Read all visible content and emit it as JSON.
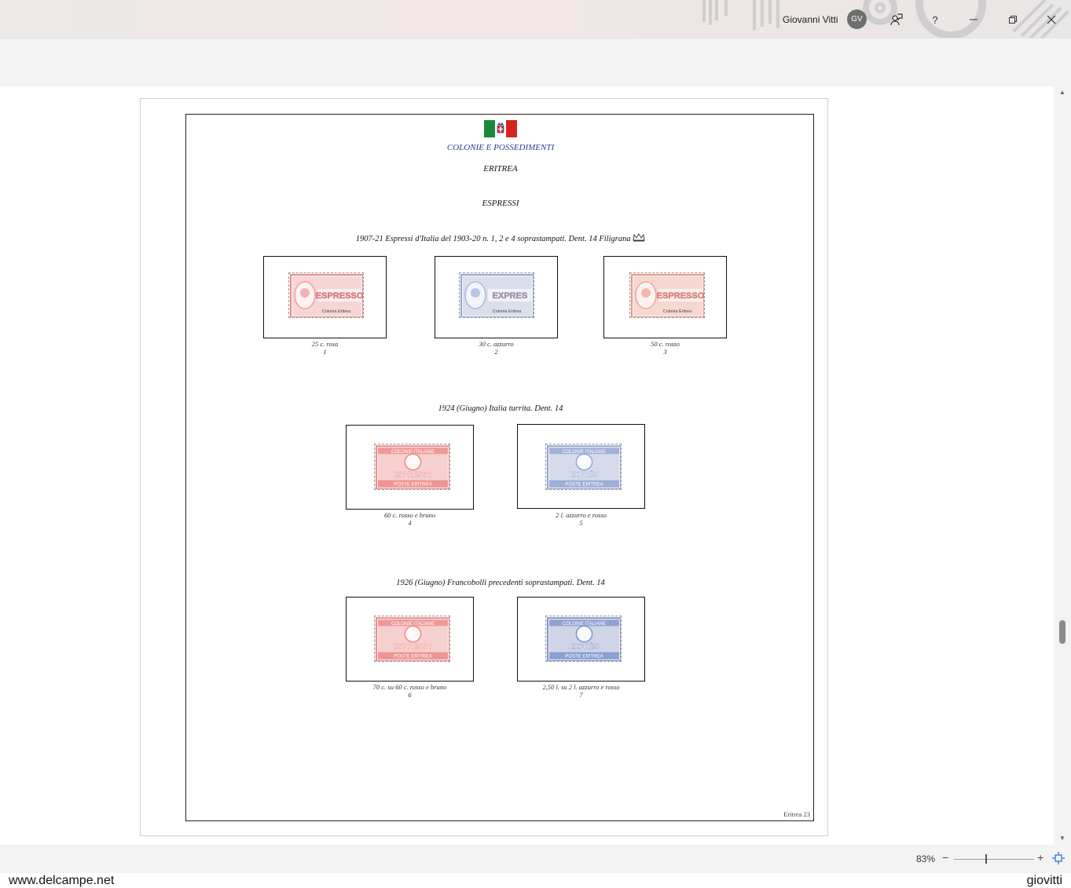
{
  "titlebar": {
    "user_name": "Giovanni Vitti",
    "avatar_initials": "GV",
    "help_label": "?"
  },
  "page": {
    "header": "COLONIE E POSSEDIMENTI",
    "country": "ERITREA",
    "section": "ESPRESSI",
    "page_number": "Eritrea 23",
    "flag_colors": [
      "#1a8a3a",
      "#ffffff",
      "#d8231c"
    ],
    "groups": [
      {
        "title": "1907-21 Espressi d'Italia del 1903-20 n. 1, 2 e 4 soprastampati. Dent. 14 Filigrana",
        "stamps": [
          {
            "caption": "25 c. rosa",
            "number": "1",
            "text": "ESPRESSO",
            "overprint": "Colonia Eritrea",
            "color": "#e88a8a"
          },
          {
            "caption": "30 c. azzurro",
            "number": "2",
            "text": "EXPRES",
            "overprint": "Colonia Eritrea",
            "color": "#8fa9d8"
          },
          {
            "caption": "50 c. rosso",
            "number": "3",
            "text": "ESPRESSO",
            "overprint": "Colonia Eritrea",
            "color": "#ec9380"
          }
        ]
      },
      {
        "title": "1924 (Giugno) Italia turrita. Dent. 14",
        "stamps": [
          {
            "caption": "60 c. rosso e bruno",
            "number": "4",
            "top": "COLONIE ITALIANE",
            "text": "ESPRESSO",
            "bottom": "POSTE ERITREA",
            "color": "#ec8a8a"
          },
          {
            "caption": "2 l. azzurro e rosso",
            "number": "5",
            "top": "COLONIE ITALIANE",
            "text": "EXPRÈS",
            "bottom": "POSTE ERITREA",
            "color": "#93a6d6"
          }
        ]
      },
      {
        "title": "1926 (Giugno) Francobolli precedenti soprastampati. Dent. 14",
        "stamps": [
          {
            "caption": "70 c. su 60 c. rosso e bruno",
            "number": "6",
            "top": "COLONIE ITALIANE",
            "text": "ESPRESSO",
            "bottom": "POSTE ERITREA",
            "color": "#ec8a8a"
          },
          {
            "caption": "2,50 l. su 2 l. azzurro e rosso",
            "number": "7",
            "top": "COLONIE ITALIANE",
            "text": "EXPRÈS",
            "bottom": "POSTE ERITREA",
            "color": "#7f95cc"
          }
        ]
      }
    ]
  },
  "statusbar": {
    "zoom": "83%",
    "zoom_minus": "−",
    "zoom_plus": "+"
  },
  "watermark": {
    "left": "www.delcampe.net",
    "right": "giovitti"
  }
}
